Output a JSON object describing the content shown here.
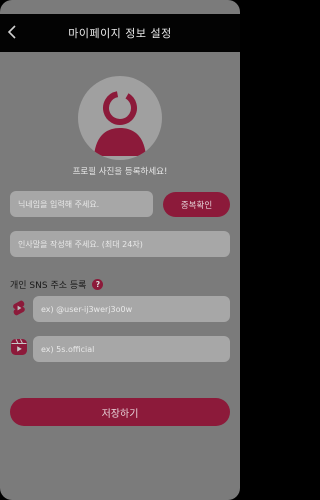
{
  "header": {
    "title": "마이페이지 정보 설정"
  },
  "profile": {
    "caption": "프로필 사진을 등록하세요!"
  },
  "nickname": {
    "placeholder": "닉네임을 입력해 주세요.",
    "check_button": "중복확인"
  },
  "greeting": {
    "placeholder": "인사말을 작성해 주세요. (최대 24자)"
  },
  "sns": {
    "title": "개인 SNS 주소 등록",
    "help": "?",
    "youtube": {
      "placeholder": "ex) @user-ij3werj3o0w"
    },
    "instagram": {
      "placeholder": "ex) 5s.official"
    }
  },
  "save_button": "저장하기",
  "colors": {
    "accent": "#8c1a3a",
    "overlay": "#7b7b7b",
    "header": "#030303"
  }
}
